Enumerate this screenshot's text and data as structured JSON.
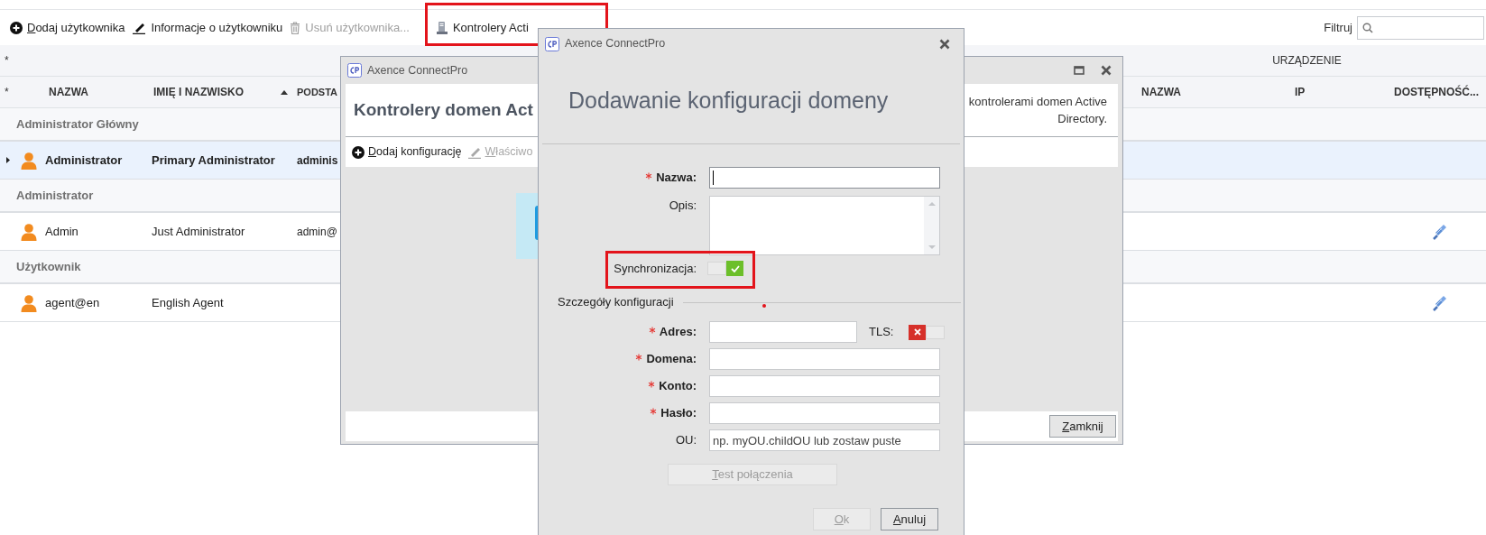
{
  "toolbar": {
    "items": [
      {
        "kind": "add",
        "label": "Dodaj użytkownika",
        "mnemonic": true,
        "disabled": false,
        "highlighted": false
      },
      {
        "kind": "edit",
        "label": "Informacje o użytkowniku",
        "mnemonic": false,
        "disabled": false,
        "highlighted": false
      },
      {
        "kind": "delete",
        "label": "Usuń użytkownika...",
        "mnemonic": false,
        "disabled": true,
        "highlighted": false
      },
      {
        "kind": "server",
        "label": "Kontrolery Acti",
        "mnemonic": false,
        "disabled": false,
        "highlighted": true
      }
    ],
    "filter": {
      "label": "Filtruj"
    }
  },
  "grid": {
    "band_marker": "*",
    "band_title": "URZĄDZENIE",
    "header_marker": "*",
    "columns": [
      {
        "label": "NAZWA",
        "sorted": false
      },
      {
        "label": "IMIĘ I NAZWISKO",
        "sorted": true
      },
      {
        "label": "PODSTA",
        "sorted": false
      },
      {
        "label": "NAZWA",
        "sorted": false
      },
      {
        "label": "IP",
        "sorted": false
      },
      {
        "label": "DOSTĘPNOŚĆ...",
        "sorted": false
      }
    ],
    "groups": [
      {
        "title": "Administrator Główny",
        "rows": [
          {
            "cells": [
              "Administrator",
              "Primary Administrator",
              "adminis"
            ],
            "selected": true,
            "available": false
          }
        ]
      },
      {
        "title": "Administrator",
        "rows": [
          {
            "cells": [
              "Admin",
              "Just Administrator",
              "admin@"
            ],
            "selected": false,
            "available": true
          }
        ]
      },
      {
        "title": "Użytkownik",
        "rows": [
          {
            "cells": [
              "agent@en",
              "English Agent"
            ],
            "selected": false,
            "available": true
          }
        ]
      }
    ]
  },
  "controllers_window": {
    "title": "Axence ConnectPro",
    "heading": "Kontrolery domen Act",
    "description": "kontrolerami domen Active Directory.",
    "toolbar": [
      {
        "kind": "add",
        "label": "Dodaj konfigurację",
        "mnemonic": true,
        "disabled": false
      },
      {
        "kind": "edit",
        "label": "Właściwo",
        "mnemonic": true,
        "disabled": true
      }
    ],
    "close_button": {
      "label": "Zamknij",
      "mnemonic": true
    }
  },
  "dialog": {
    "title": "Axence ConnectPro",
    "heading": "Dodawanie konfiguracji domeny",
    "fields": [
      {
        "kind": "text",
        "label": "Nazwa:",
        "required": true,
        "focused": true
      },
      {
        "kind": "textarea",
        "label": "Opis:",
        "required": false,
        "focused": false
      },
      {
        "kind": "toggle",
        "label": "Synchronizacja:",
        "on": true,
        "highlighted": true
      },
      {
        "kind": "section",
        "label": "Szczegóły konfiguracji"
      },
      {
        "kind": "text",
        "label": "Adres:",
        "required": true,
        "focused": false,
        "addon": {
          "label": "TLS:",
          "on": false
        }
      },
      {
        "kind": "text",
        "label": "Domena:",
        "required": true,
        "focused": false
      },
      {
        "kind": "text",
        "label": "Konto:",
        "required": true,
        "focused": false
      },
      {
        "kind": "text",
        "label": "Hasło:",
        "required": true,
        "focused": false
      },
      {
        "kind": "text",
        "label": "OU:",
        "required": false,
        "focused": false,
        "placeholder": "np. myOU.childOU lub zostaw puste"
      }
    ],
    "test_button": {
      "label": "Test połączenia",
      "mnemonic": true,
      "disabled": true
    },
    "buttons": [
      {
        "label": "Ok",
        "mnemonic": true,
        "disabled": true
      },
      {
        "label": "Anuluj",
        "mnemonic": true,
        "disabled": false
      }
    ]
  }
}
